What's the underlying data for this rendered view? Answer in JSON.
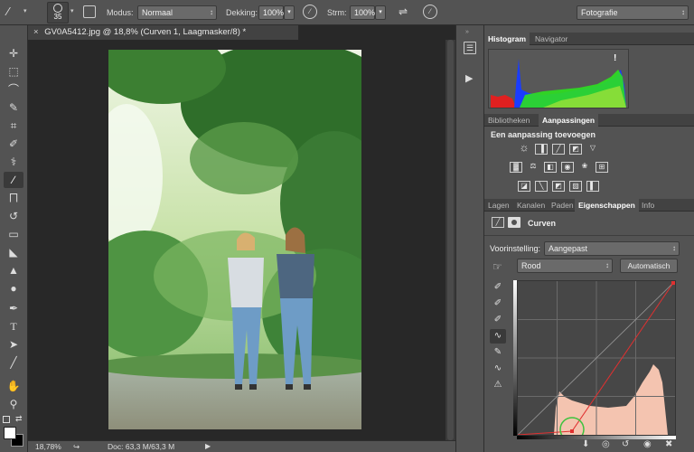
{
  "options_bar": {
    "brush_size": "35",
    "mode_label": "Modus:",
    "mode_value": "Normaal",
    "opacity_label": "Dekking:",
    "opacity_value": "100%",
    "flow_label": "Strm:",
    "flow_value": "100%",
    "workspace": "Fotografie"
  },
  "document": {
    "tab_title": "GV0A5412.jpg @ 18,8% (Curven 1, Laagmasker/8) *",
    "close_symbol": "×"
  },
  "status_bar": {
    "zoom": "18,78%",
    "doc_info": "Doc: 63,3 M/63,3 M"
  },
  "panels": {
    "histogram_tabs": [
      "Histogram",
      "Navigator"
    ],
    "histogram_warning": "!",
    "adjust_tabs": [
      "Bibliotheken",
      "Aanpassingen"
    ],
    "add_adjustment": "Een aanpassing toevoegen",
    "props_tabs": [
      "Lagen",
      "Kanalen",
      "Paden",
      "Eigenschappen",
      "Info"
    ],
    "properties_title": "Curven",
    "preset_label": "Voorinstelling:",
    "preset_value": "Aangepast",
    "channel_value": "Rood",
    "auto_button": "Automatisch"
  },
  "colors": {
    "app_bg": "#535353",
    "canvas_bg": "#282828",
    "histogram_red": "#e02020",
    "histogram_blue": "#1a3cff",
    "histogram_green": "#2ee020",
    "curve_histogram": "#f4c4b0",
    "curve_line": "#e03030"
  }
}
